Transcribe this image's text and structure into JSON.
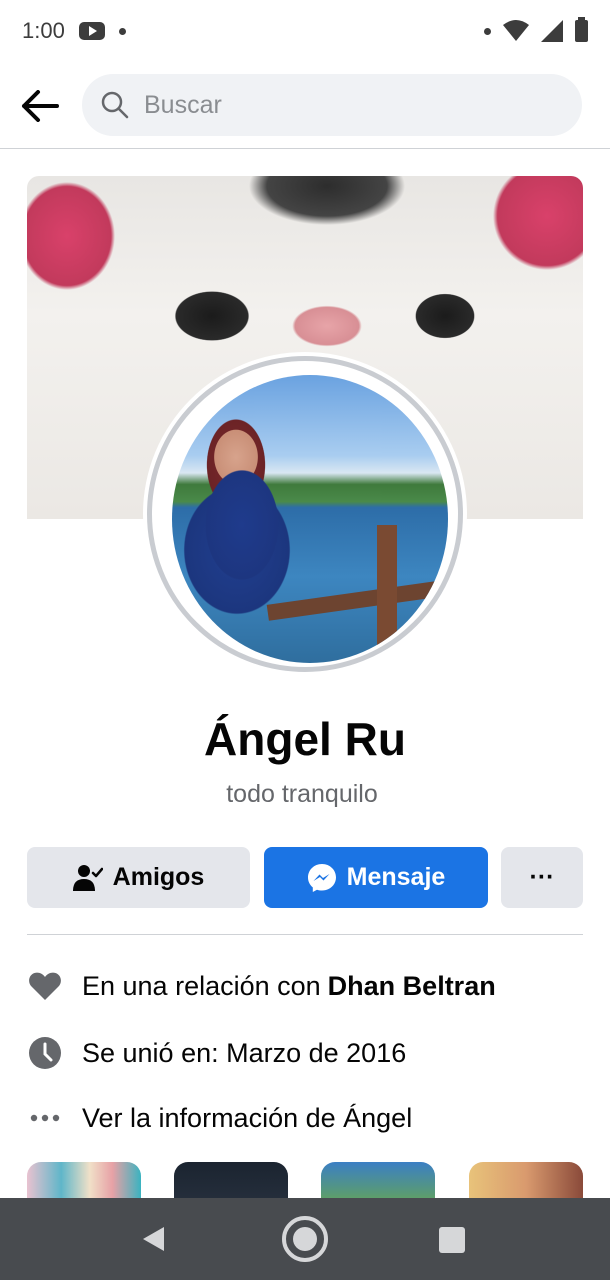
{
  "status_bar": {
    "time": "1:00",
    "icons": [
      "youtube-icon",
      "notification-dot",
      "wifi-icon",
      "signal-icon",
      "battery-icon"
    ]
  },
  "header": {
    "search_placeholder": "Buscar",
    "back_icon": "arrow-left-icon",
    "search_icon": "search-icon"
  },
  "profile": {
    "name": "Ángel Ru",
    "bio": "todo tranquilo"
  },
  "actions": {
    "friends_label": "Amigos",
    "message_label": "Mensaje",
    "more_label": "···"
  },
  "info": {
    "relationship_prefix": "En una relación con",
    "relationship_partner": "Dhan Beltran",
    "joined": "Se unió en: Marzo de 2016",
    "see_info": "Ver la información de Ángel"
  },
  "colors": {
    "accent": "#1b74e4",
    "secondary_button": "#e4e6eb",
    "search_bg": "#f0f2f5",
    "nav_bar": "#484b4f",
    "muted_text": "#65676b"
  }
}
